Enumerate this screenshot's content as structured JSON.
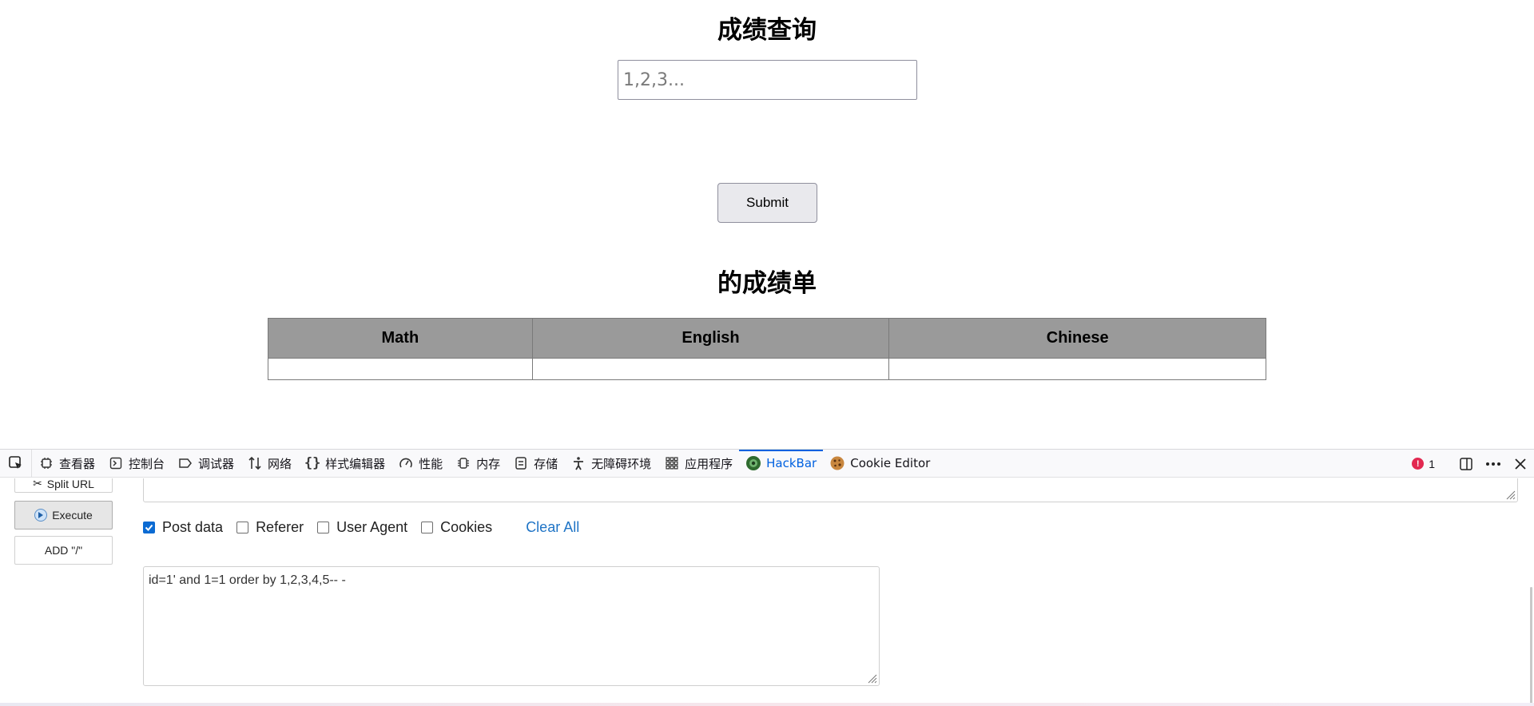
{
  "page": {
    "title": "成绩查询",
    "input_placeholder": "1,2,3...",
    "submit_label": "Submit",
    "report_title": "的成绩单",
    "table": {
      "headers": [
        "Math",
        "English",
        "Chinese"
      ],
      "rows": [
        [
          "",
          "",
          ""
        ]
      ]
    }
  },
  "devtools": {
    "tabs": [
      {
        "label": "查看器",
        "icon": "inspector-icon"
      },
      {
        "label": "控制台",
        "icon": "console-icon"
      },
      {
        "label": "调试器",
        "icon": "debugger-icon"
      },
      {
        "label": "网络",
        "icon": "network-icon"
      },
      {
        "label": "样式编辑器",
        "icon": "style-editor-icon"
      },
      {
        "label": "性能",
        "icon": "performance-icon"
      },
      {
        "label": "内存",
        "icon": "memory-icon"
      },
      {
        "label": "存储",
        "icon": "storage-icon"
      },
      {
        "label": "无障碍环境",
        "icon": "accessibility-icon"
      },
      {
        "label": "应用程序",
        "icon": "application-icon"
      },
      {
        "label": "HackBar",
        "icon": "hackbar-icon",
        "active": true
      },
      {
        "label": "Cookie Editor",
        "icon": "cookie-icon"
      }
    ],
    "error_count": "1",
    "accent_color": "#0061e0"
  },
  "hackbar": {
    "split_url_label": "Split URL",
    "execute_label": "Execute",
    "add_slash_label": "ADD \"/\"",
    "options": {
      "post_data": {
        "label": "Post data",
        "checked": true
      },
      "referer": {
        "label": "Referer",
        "checked": false
      },
      "user_agent": {
        "label": "User Agent",
        "checked": false
      },
      "cookies": {
        "label": "Cookies",
        "checked": false
      }
    },
    "clear_all_label": "Clear All",
    "post_body": "id=1' and 1=1 order by 1,2,3,4,5-- -"
  }
}
